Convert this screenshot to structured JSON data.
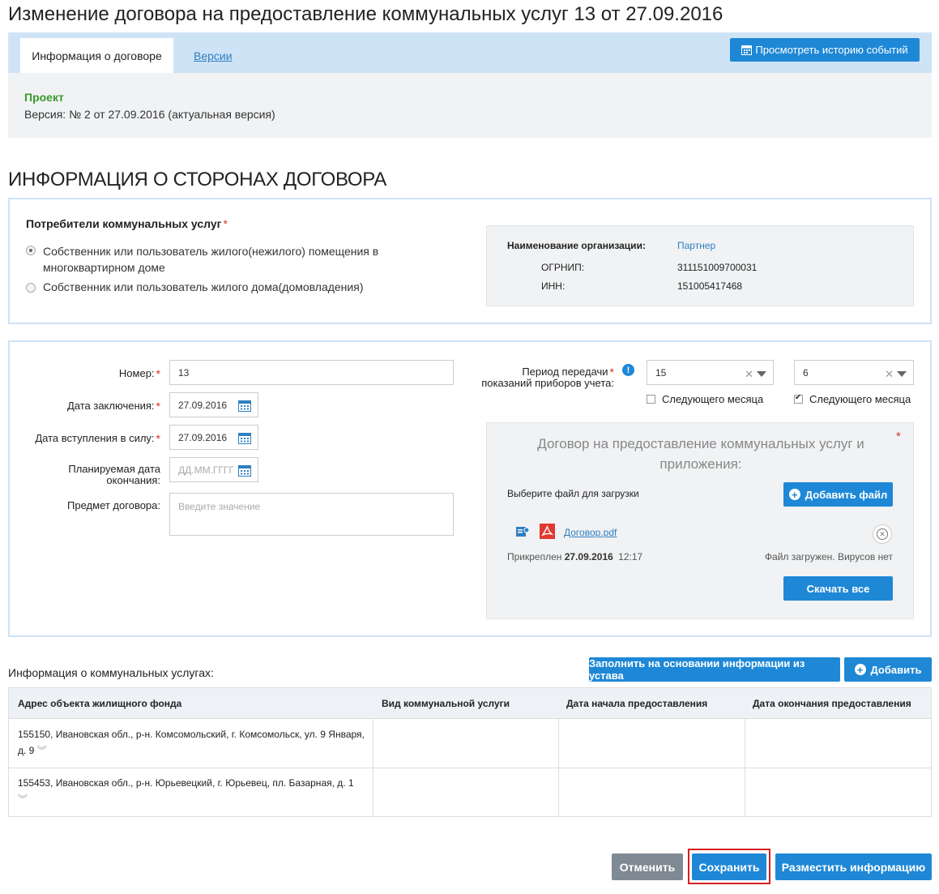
{
  "page": {
    "title": "Изменение договора на предоставление коммунальных услуг 13 от 27.09.2016"
  },
  "tabs": {
    "info": "Информация о договоре",
    "versions": "Версии",
    "history_button": "Просмотреть историю событий"
  },
  "status": {
    "state": "Проект",
    "version": "Версия: № 2 от 27.09.2016 (актуальная версия)"
  },
  "parties": {
    "section_title": "ИНФОРМАЦИЯ О СТОРОНАХ ДОГОВОРА",
    "consumers_label": "Потребители коммунальных услуг",
    "required_mark": "*",
    "option1_line1": "Собственник или пользователь жилого(нежилого) помещения в",
    "option1_line2": "многоквартирном доме",
    "option2": "Собственник или пользователь жилого дома(домовладения)",
    "selected_option": 1,
    "org": {
      "name_label": "Наименование организации:",
      "name_value": "Партнер",
      "ogrnip_label": "ОГРНИП:",
      "ogrnip_value": "311151009700031",
      "inn_label": "ИНН:",
      "inn_value": "151005417468"
    }
  },
  "form": {
    "number_label": "Номер:",
    "number_value": "13",
    "conclusion_label": "Дата заключения:",
    "conclusion_value": "27.09.2016",
    "effective_label": "Дата вступления в силу:",
    "effective_value": "27.09.2016",
    "planned_end_label_1": "Планируемая дата",
    "planned_end_label_2": "окончания:",
    "planned_end_placeholder": "ДД.ММ.ГГГГ",
    "subject_label": "Предмет договора:",
    "subject_placeholder": "Введите значение",
    "period_label_1": "Период передачи",
    "period_label_2": "показаний приборов учета:",
    "period_from": "15",
    "period_to": "6",
    "next_month_label": "Следующего месяца",
    "next_month_from_checked": false,
    "next_month_to_checked": true
  },
  "document": {
    "title_line1": "Договор на предоставление коммунальных услуг и",
    "title_line2": "приложения:",
    "choose_file": "Выберите файл для загрузки",
    "add_file_button": "Добавить файл",
    "file_name": "Договор.pdf",
    "attached_prefix": "Прикреплен",
    "attached_date": "27.09.2016",
    "attached_time": "12:17",
    "file_status": "Файл загружен. Вирусов нет",
    "download_all_button": "Скачать все"
  },
  "services": {
    "label": "Информация о коммунальных услугах:",
    "fill_button": "Заполнить на основании информации из устава",
    "add_button": "Добавить",
    "columns": [
      "Адрес объекта жилищного фонда",
      "Вид коммунальной услуги",
      "Дата начала предоставления",
      "Дата окончания предоставления"
    ],
    "rows": [
      {
        "address_line1": "155150, Ивановская обл., р-н. Комсомольский, г. Комсомольск, ул. 9 Января,",
        "address_line2": "д. 9"
      },
      {
        "address_line1": "155453, Ивановская обл., р-н. Юрьевецкий, г. Юрьевец, пл. Базарная, д. 1",
        "address_line2": ""
      }
    ]
  },
  "footer": {
    "cancel_button": "Отменить",
    "save_button": "Сохранить",
    "publish_button": "Разместить информацию"
  },
  "colors": {
    "accent": "#1e88d6",
    "tab_bar": "#cfe3f6",
    "status_green": "#3a9a2a",
    "required_red": "#d0312d",
    "highlight_red": "#d42020"
  }
}
